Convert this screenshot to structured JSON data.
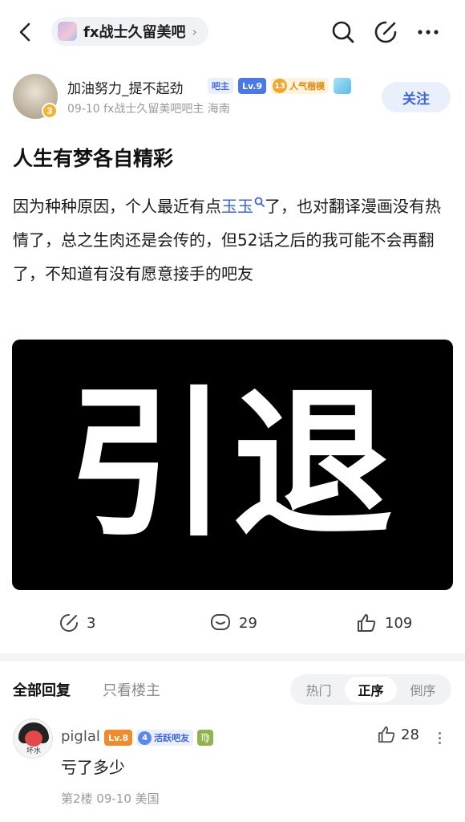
{
  "nav": {
    "forum_name": "fx战士久留美吧",
    "chevron": "›",
    "icons": [
      "back-icon",
      "search-icon",
      "edit-icon",
      "more-icon"
    ]
  },
  "author": {
    "name": "加油努力_提不起劲",
    "avatar_badge": "3",
    "badge_owner": "吧主",
    "badge_level": "Lv.9",
    "badge_popular_num": "13",
    "badge_popular": "人气楷模",
    "meta": "09-10  fx战士久留美吧吧主  海南",
    "follow_label": "关注"
  },
  "post": {
    "title": "人生有梦各自精彩",
    "body_before": "因为种种原因，个人最近有点",
    "body_link": "玉玉",
    "body_after": "了，也对翻译漫画没有热情了，总之生肉还是会传的，但52话之后的我可能不会再翻了，不知道有没有愿意接手的吧友",
    "image_text": "引退"
  },
  "actions": {
    "share_count": "3",
    "comment_count": "29",
    "like_count": "109"
  },
  "replies_header": {
    "tab_all": "全部回复",
    "tab_owner_only": "只看楼主",
    "sort_options": [
      "热门",
      "正序",
      "倒序"
    ],
    "sort_active": "正序"
  },
  "reply": {
    "avatar_text": "坏水",
    "name": "piglal",
    "badge_level": "Lv.8",
    "badge_active_num": "4",
    "badge_active": "活跃吧友",
    "badge_zodiac": "♍",
    "like_count": "28",
    "text": "亏了多少",
    "meta": "第2楼  09-10  美国"
  },
  "colors": {
    "accent": "#3d63d6",
    "muted": "#9a9a9a",
    "pill_bg": "#f1f2f6"
  }
}
